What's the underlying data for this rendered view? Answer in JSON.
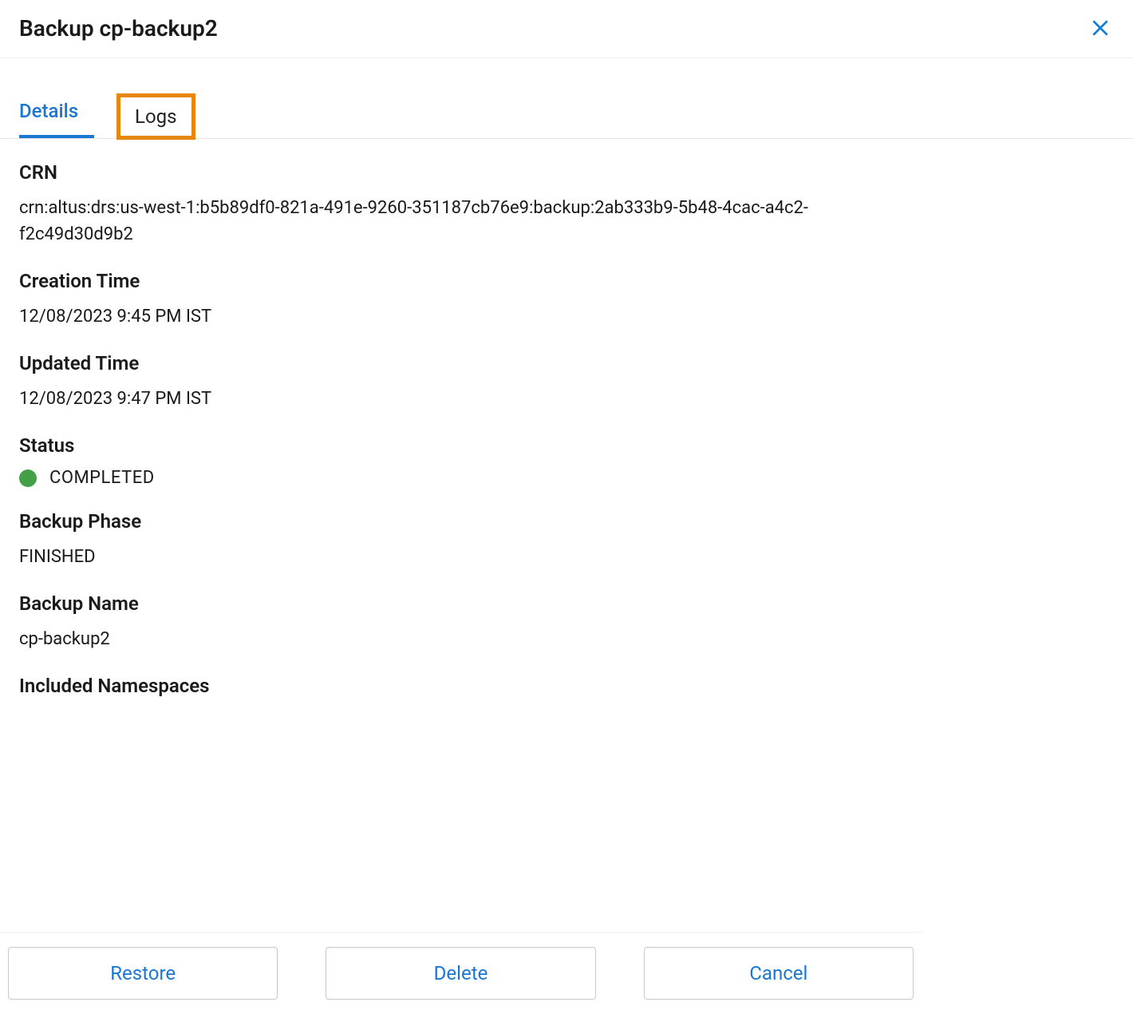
{
  "header": {
    "title": "Backup cp-backup2"
  },
  "tabs": {
    "details": "Details",
    "logs": "Logs"
  },
  "fields": {
    "crn": {
      "label": "CRN",
      "value": "crn:altus:drs:us-west-1:b5b89df0-821a-491e-9260-351187cb76e9:backup:2ab333b9-5b48-4cac-a4c2-f2c49d30d9b2"
    },
    "creation_time": {
      "label": "Creation Time",
      "value": "12/08/2023 9:45 PM IST"
    },
    "updated_time": {
      "label": "Updated Time",
      "value": "12/08/2023 9:47 PM IST"
    },
    "status": {
      "label": "Status",
      "value": "COMPLETED",
      "color": "#43a047"
    },
    "backup_phase": {
      "label": "Backup Phase",
      "value": "FINISHED"
    },
    "backup_name": {
      "label": "Backup Name",
      "value": "cp-backup2"
    },
    "included_namespaces": {
      "label": "Included Namespaces"
    }
  },
  "footer": {
    "restore": "Restore",
    "delete": "Delete",
    "cancel": "Cancel"
  }
}
